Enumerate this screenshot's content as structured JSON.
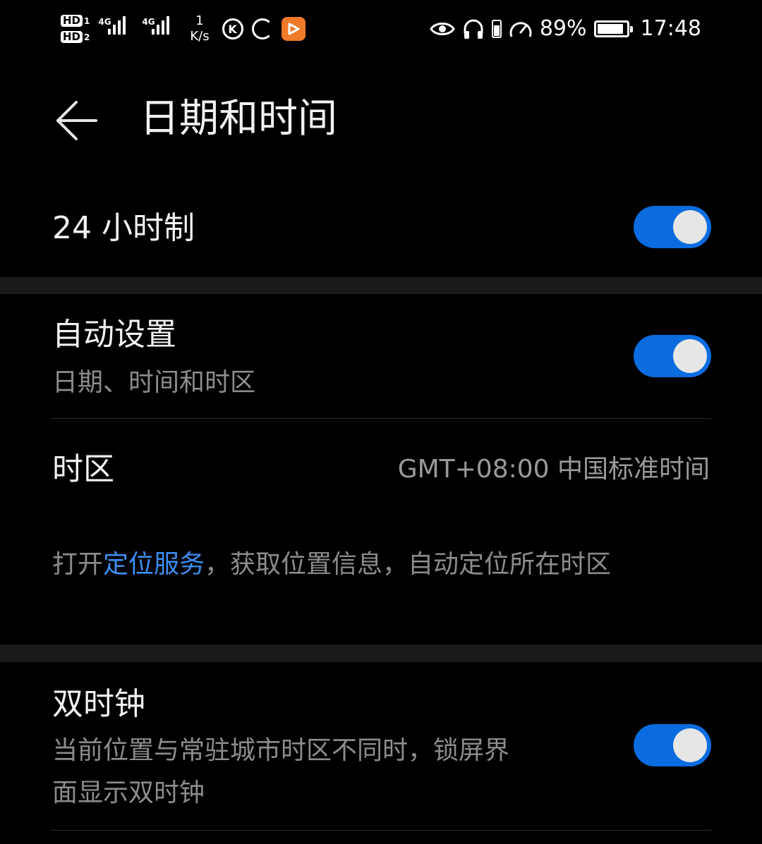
{
  "status_bar": {
    "hd1": "HD",
    "hd1_num": "1",
    "hd2": "HD",
    "hd2_num": "2",
    "sig1_tag": "4G",
    "sig2_tag": "4G",
    "speed_value": "1",
    "speed_unit": "K/s",
    "k_icon_letter": "K",
    "battery_percent": "89%",
    "battery_level": 0.89,
    "time": "17:48"
  },
  "header": {
    "title": "日期和时间"
  },
  "settings": {
    "hour24": {
      "label": "24 小时制",
      "enabled": true
    },
    "auto": {
      "label": "自动设置",
      "sub": "日期、时间和时区",
      "enabled": true
    },
    "timezone": {
      "label": "时区",
      "value": "GMT+08:00 中国标准时间"
    },
    "location_hint": {
      "prefix": "打开",
      "link": "定位服务",
      "suffix": "，获取位置信息，自动定位所在时区"
    },
    "dual_clock": {
      "label": "双时钟",
      "sub_line1": "当前位置与常驻城市时区不同时，锁屏界",
      "sub_line2": "面显示双时钟",
      "enabled": true
    }
  },
  "colors": {
    "accent": "#0A6CDF",
    "link": "#3D8FF0",
    "background": "#000000",
    "band": "#1B1B1B"
  }
}
